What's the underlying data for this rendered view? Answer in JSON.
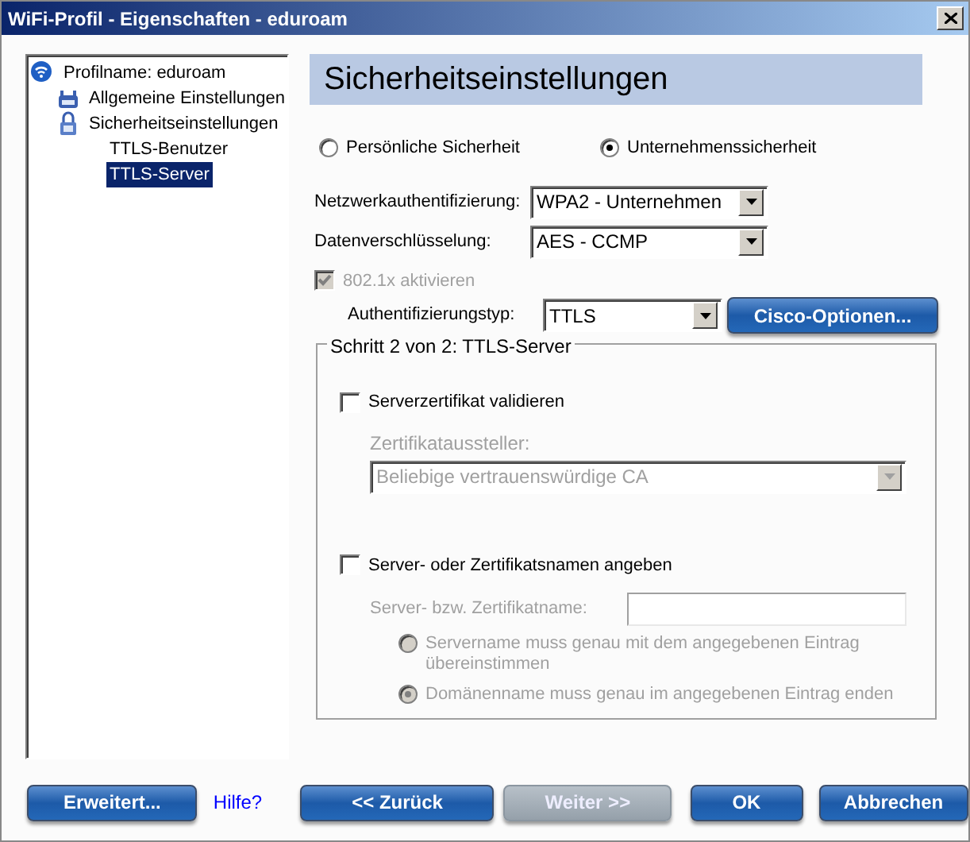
{
  "window": {
    "title": "WiFi-Profil - Eigenschaften - eduroam"
  },
  "tree": [
    {
      "label": "Profilname: eduroam",
      "kind": "wifi",
      "selected": false,
      "children": [
        {
          "label": "Allgemeine Einstellungen",
          "kind": "network",
          "selected": false
        },
        {
          "label": "Sicherheitseinstellungen",
          "kind": "lock",
          "selected": false,
          "children": [
            {
              "label": "TTLS-Benutzer",
              "selected": false
            },
            {
              "label": "TTLS-Server",
              "selected": true
            }
          ]
        }
      ]
    }
  ],
  "page_title": "Sicherheitseinstellungen",
  "security_mode": [
    {
      "label": "Persönliche Sicherheit",
      "selected": false
    },
    {
      "label": "Unternehmenssicherheit",
      "selected": true
    }
  ],
  "fields": [
    {
      "label": "Netzwerkauthentifizierung:",
      "value": "WPA2 - Unternehmen"
    },
    {
      "label": "Datenverschlüsselung:",
      "value": "AES - CCMP"
    }
  ],
  "enable_8021x": {
    "label": "802.1x aktivieren",
    "checked": true,
    "disabled": true
  },
  "auth_type": {
    "label": "Authentifizierungstyp:",
    "value": "TTLS"
  },
  "cisco_button": "Cisco-Optionen...",
  "group": {
    "title": "Schritt 2 von 2: TTLS-Server",
    "validate": {
      "label": "Serverzertifikat validieren",
      "checked": false
    },
    "issuer_label": "Zertifikataussteller:",
    "issuer": {
      "value": "Beliebige vertrauenswürdige CA",
      "disabled": true
    },
    "specify": {
      "label": "Server- oder Zertifikatsnamen angeben",
      "checked": false
    },
    "name_label": "Server- bzw. Zertifikatname:",
    "name_field": {
      "disabled": true
    },
    "match": [
      {
        "label": "Servername muss genau mit dem angegebenen Eintrag übereinstimmen",
        "selected": false,
        "disabled": true
      },
      {
        "label": "Domänenname muss genau im angegebenen Eintrag enden",
        "selected": true,
        "disabled": true
      }
    ]
  },
  "footer": {
    "advanced": "Erweitert...",
    "help": "Hilfe?",
    "buttons": [
      {
        "label": "<< Zurück",
        "disabled": false
      },
      {
        "label": "Weiter >>",
        "disabled": true
      },
      {
        "label": "OK",
        "disabled": false
      },
      {
        "label": "Abbrechen",
        "disabled": false
      }
    ]
  }
}
